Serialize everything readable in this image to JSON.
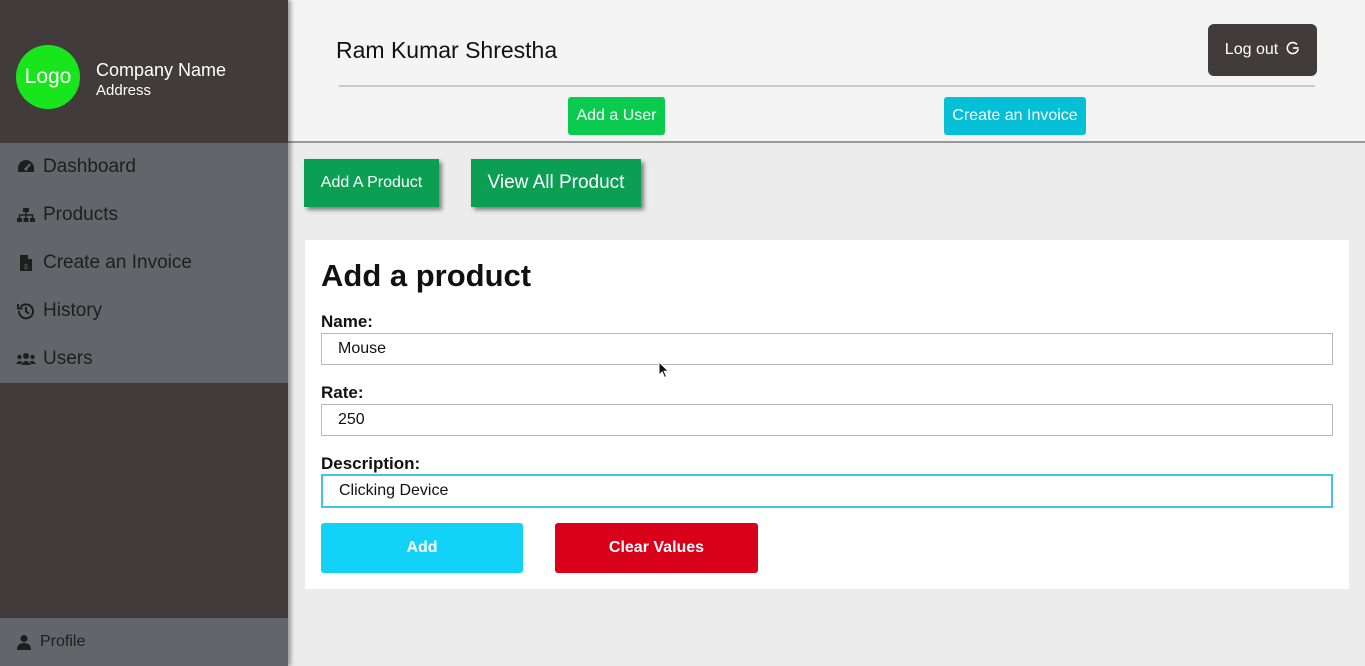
{
  "company": {
    "logo_text": "Logo",
    "name": "Company Name",
    "address": "Address"
  },
  "sidebar": {
    "items": [
      {
        "label": "Dashboard",
        "icon": "dashboard-icon"
      },
      {
        "label": "Products",
        "icon": "sitemap-icon"
      },
      {
        "label": "Create an Invoice",
        "icon": "invoice-file-icon"
      },
      {
        "label": "History",
        "icon": "history-icon"
      },
      {
        "label": "Users",
        "icon": "users-icon"
      }
    ],
    "profile_label": "Profile"
  },
  "header": {
    "user_name": "Ram Kumar Shrestha",
    "logout_label": "Log out",
    "add_user_label": "Add a User",
    "create_invoice_label": "Create an Invoice"
  },
  "actions": {
    "add_product_label": "Add A Product",
    "view_all_label": "View All Product"
  },
  "form": {
    "title": "Add a product",
    "name_label": "Name:",
    "name_value": "Mouse",
    "rate_label": "Rate:",
    "rate_value": "250",
    "description_label": "Description:",
    "description_value": "Clicking Device",
    "add_label": "Add",
    "clear_label": "Clear Values"
  },
  "colors": {
    "sidebar_bg": "#413b3b",
    "nav_bg": "#62656a",
    "logo_green": "#19e51c",
    "green_button": "#0b9f53",
    "add_user_green": "#0bcb4f",
    "cyan_button": "#05bfd6",
    "add_cyan": "#12d3f7",
    "clear_red": "#d9001a"
  }
}
